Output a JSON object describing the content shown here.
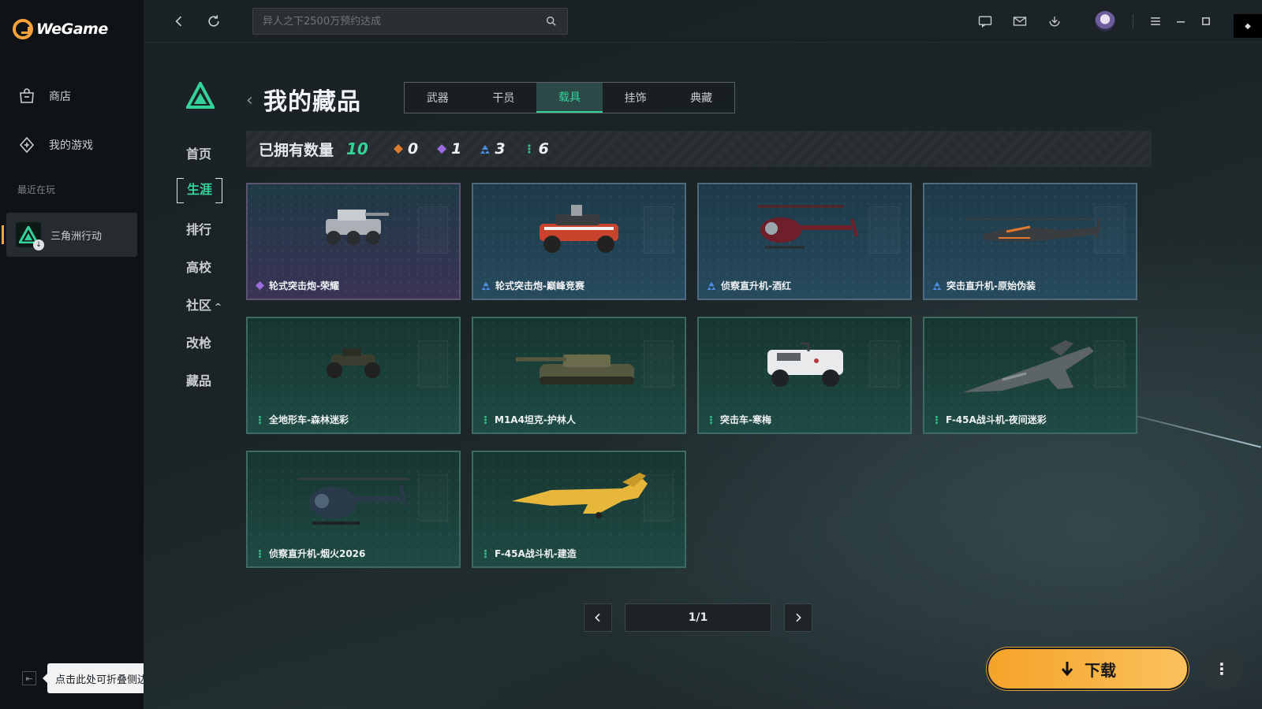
{
  "app": {
    "logo_text": "WeGame"
  },
  "sidebar": {
    "items": [
      {
        "label": "商店",
        "icon": "shop-bag-icon"
      },
      {
        "label": "我的游戏",
        "icon": "gamepad-icon"
      }
    ],
    "recent_label": "最近在玩",
    "recent_game": {
      "label": "三角洲行动"
    },
    "collapse_tooltip": "点击此处可折叠侧边栏"
  },
  "topbar": {
    "search_placeholder": "异人之下2500万预约达成",
    "icons": [
      "back-icon",
      "refresh-icon",
      "search-icon",
      "chat-icon",
      "mail-icon",
      "download-manager-icon",
      "avatar",
      "menu-icon",
      "minimize-icon",
      "maximize-icon"
    ]
  },
  "game_nav": {
    "items": [
      "首页",
      "生涯",
      "排行",
      "高校",
      "社区",
      "改枪",
      "藏品"
    ],
    "active_index": 1
  },
  "page": {
    "title": "我的藏品",
    "tabs": [
      "武器",
      "干员",
      "载具",
      "挂饰",
      "典藏"
    ],
    "active_tab": 2
  },
  "summary": {
    "label": "已拥有数量",
    "total": "10",
    "rarities": [
      {
        "value": "0",
        "color": "#e07a2e"
      },
      {
        "value": "1",
        "color": "#9b6be0"
      },
      {
        "value": "3",
        "color": "#4a8ee0"
      },
      {
        "value": "6",
        "color": "#2fc08a"
      }
    ]
  },
  "items": [
    {
      "name": "轮式突击炮-荣耀",
      "rarity": "purple",
      "icon": "armored-car-icon"
    },
    {
      "name": "轮式突击炮-巅峰竞赛",
      "rarity": "blue",
      "icon": "armored-car-icon"
    },
    {
      "name": "侦察直升机-酒红",
      "rarity": "blue",
      "icon": "helicopter-icon"
    },
    {
      "name": "突击直升机-原始伪装",
      "rarity": "blue",
      "icon": "attack-helicopter-icon"
    },
    {
      "name": "全地形车-森林迷彩",
      "rarity": "green",
      "icon": "atv-icon"
    },
    {
      "name": "M1A4坦克-护林人",
      "rarity": "green",
      "icon": "tank-icon"
    },
    {
      "name": "突击车-寒梅",
      "rarity": "green",
      "icon": "assault-vehicle-icon"
    },
    {
      "name": "F-45A战斗机-夜间迷彩",
      "rarity": "green",
      "icon": "fighter-jet-icon"
    },
    {
      "name": "侦察直升机-烟火2026",
      "rarity": "green",
      "icon": "helicopter-icon"
    },
    {
      "name": "F-45A战斗机-建造",
      "rarity": "green",
      "icon": "fighter-jet-icon"
    }
  ],
  "pagination": {
    "label": "1/1"
  },
  "download": {
    "label": "下载"
  }
}
